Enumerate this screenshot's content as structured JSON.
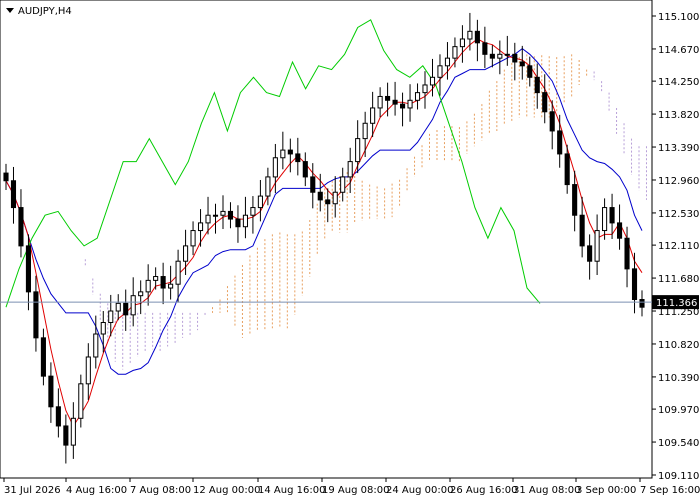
{
  "chart_data": {
    "type": "candlestick",
    "symbol_title": "AUDJPY,H4",
    "timeframe": "H4",
    "indicator": "Ichimoku Kinko Hyo",
    "current_price": 111.366,
    "y_range": [
      109.11,
      115.2
    ],
    "y_ticks": [
      "115.100",
      "114.670",
      "114.250",
      "113.820",
      "113.390",
      "112.960",
      "112.530",
      "112.110",
      "111.680",
      "111.250",
      "110.820",
      "110.390",
      "109.970",
      "109.540",
      "109.110"
    ],
    "x_ticks": [
      "31 Jul 2026",
      "4 Aug 16:00",
      "7 Aug 08:00",
      "12 Aug 00:00",
      "14 Aug 16:00",
      "19 Aug 08:00",
      "24 Aug 00:00",
      "26 Aug 16:00",
      "31 Aug 08:00",
      "3 Sep 00:00",
      "7 Sep 16:00"
    ],
    "colors": {
      "tenkan_sen": "#e00000",
      "kijun_sen": "#0000cc",
      "chikou_span": "#00cc00",
      "kumo_bullish": "#e8a060",
      "kumo_bearish": "#b8a0d8",
      "candle": "#000000",
      "price_line": "#7a8fb0"
    },
    "candles_close": [
      112.95,
      112.6,
      112.1,
      111.5,
      110.9,
      110.4,
      110.0,
      109.75,
      109.5,
      109.85,
      110.3,
      110.65,
      110.95,
      111.1,
      111.25,
      111.35,
      111.2,
      111.45,
      111.5,
      111.65,
      111.7,
      111.55,
      111.6,
      111.9,
      112.1,
      112.3,
      112.4,
      112.5,
      112.5,
      112.55,
      112.45,
      112.35,
      112.5,
      112.6,
      112.75,
      113.0,
      113.25,
      113.35,
      113.3,
      113.2,
      113.0,
      112.8,
      112.7,
      112.65,
      112.8,
      113.0,
      113.2,
      113.5,
      113.7,
      113.9,
      114.05,
      114.0,
      113.95,
      113.9,
      114.0,
      114.1,
      114.2,
      114.3,
      114.45,
      114.55,
      114.7,
      114.8,
      114.9,
      114.75,
      114.6,
      114.55,
      114.6,
      114.6,
      114.5,
      114.45,
      114.3,
      114.1,
      113.85,
      113.6,
      113.3,
      112.9,
      112.5,
      112.1,
      111.9,
      112.3,
      112.6,
      112.4,
      112.2,
      111.8,
      111.4,
      111.3
    ],
    "chikou_span": [
      111.3,
      111.8,
      112.2,
      112.5,
      112.55,
      112.3,
      112.1,
      112.2,
      112.7,
      113.2,
      113.2,
      113.5,
      113.2,
      112.9,
      113.2,
      113.7,
      114.1,
      113.6,
      114.1,
      114.3,
      114.1,
      114.05,
      114.5,
      114.15,
      114.45,
      114.4,
      114.6,
      114.95,
      115.05,
      114.65,
      114.4,
      114.3,
      114.45,
      114.2,
      113.7,
      113.2,
      112.6,
      112.2,
      112.6,
      112.3,
      111.55,
      111.35
    ]
  }
}
